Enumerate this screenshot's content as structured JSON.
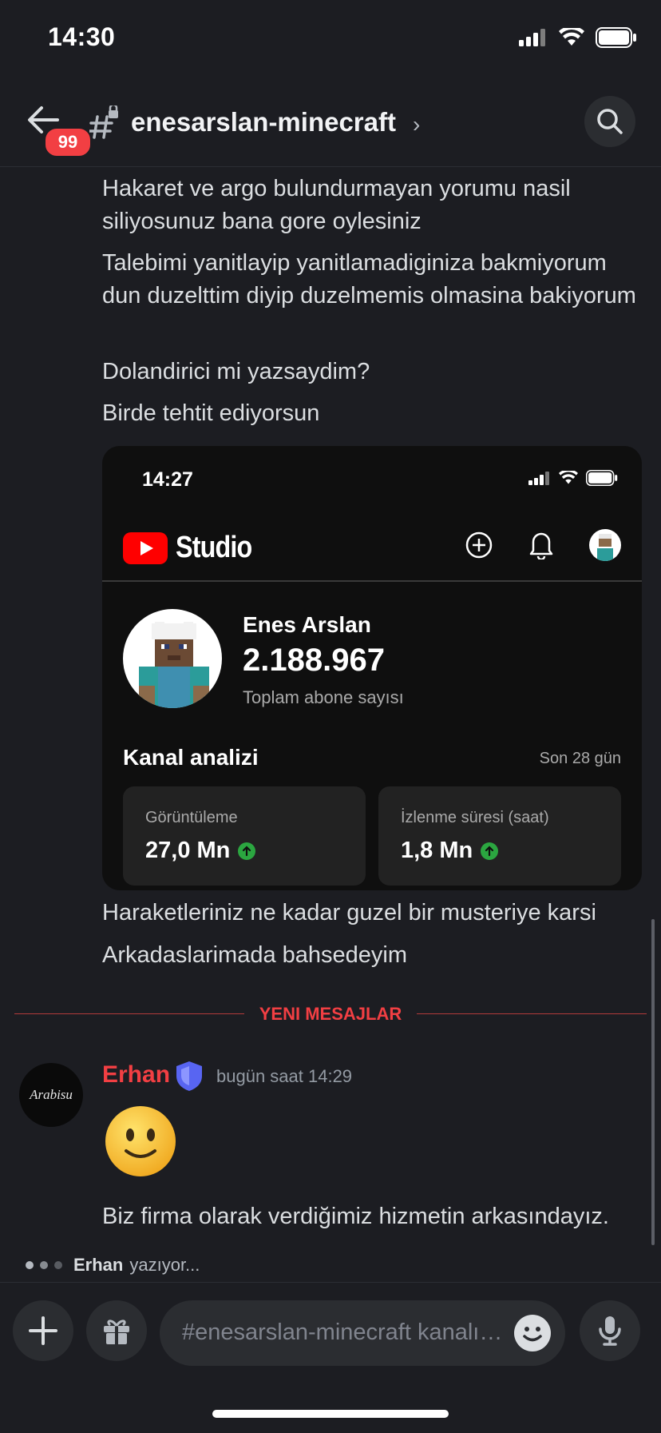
{
  "status_bar": {
    "time": "14:30"
  },
  "header": {
    "back_badge": "99",
    "channel_name": "enesarslan-minecraft",
    "chevron": "›"
  },
  "messages_before": [
    "Hakaret ve argo bulundurmayan yorumu nasil siliyosunuz bana gore oylesiniz",
    "Talebimi yanitlayip yanitlamadiginiza bakmiyorum dun duzelttim diyip duzelmemis olmasina bakiyorum",
    "Dolandirici mi yazsaydim?",
    "Birde tehtit ediyorsun"
  ],
  "embed": {
    "time": "14:27",
    "app": "Studio",
    "name": "Enes Arslan",
    "subscriber_count": "2.188.967",
    "subscriber_label": "Toplam abone sayısı",
    "analysis_title": "Kanal analizi",
    "period": "Son 28 gün",
    "cards": [
      {
        "label": "Görüntüleme",
        "value": "27,0 Mn"
      },
      {
        "label": "İzlenme süresi (saat)",
        "value": "1,8 Mn"
      }
    ]
  },
  "messages_after": [
    "Haraketleriniz ne kadar guzel bir musteriye karsi",
    "Arkadaslarimada bahsedeyim"
  ],
  "new_messages_label": "YENI MESAJLAR",
  "reply": {
    "author": "Erhan",
    "avatar_text": "Arabisu",
    "time": "bugün saat 14:29",
    "text": "Biz firma olarak verdiğimiz hizmetin arkasındayız."
  },
  "typing": {
    "name": "Erhan",
    "suffix": "yazıyor..."
  },
  "composer": {
    "placeholder": "#enesarslan-minecraft kanalına mesaj gönder"
  },
  "colors": {
    "accent_red": "#f23f43",
    "background": "#1c1d22",
    "brand_blurple": "#5865f2",
    "youtube_red": "#ff0000"
  }
}
